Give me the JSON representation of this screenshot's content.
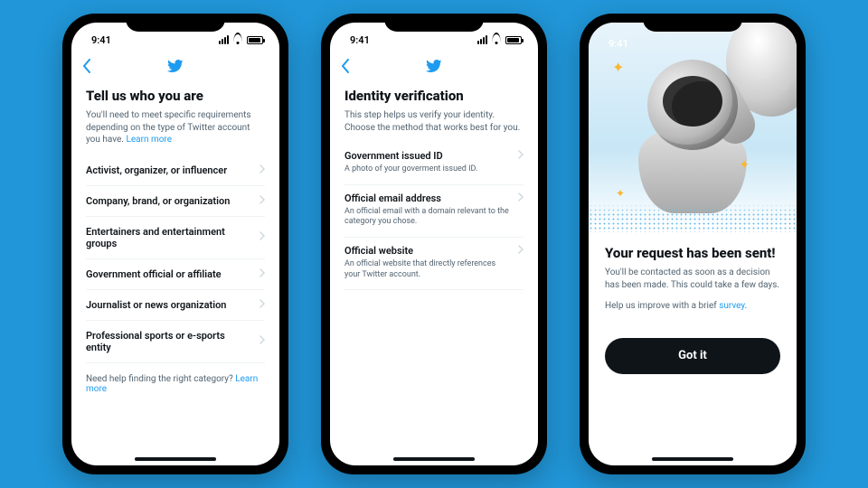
{
  "status": {
    "time": "9:41"
  },
  "brand": {
    "accent": "#1d9bf0"
  },
  "phone1": {
    "title": "Tell us who you are",
    "sub": "You'll need to meet specific requirements depending on the type of Twitter account you have.",
    "learn_more": "Learn more",
    "categories": [
      "Activist, organizer, or influencer",
      "Company, brand, or organization",
      "Entertainers and entertainment groups",
      "Government official or affiliate",
      "Journalist or news organization",
      "Professional sports or e-sports entity"
    ],
    "helper_prefix": "Need help finding the right category? ",
    "helper_link": "Learn more"
  },
  "phone2": {
    "title": "Identity verification",
    "sub": "This step helps us verify your identity. Choose the method that works best for you.",
    "options": [
      {
        "label": "Government issued ID",
        "desc": "A photo of your goverment issued ID."
      },
      {
        "label": "Official email address",
        "desc": "An official email with a domain relevant to the category you chose."
      },
      {
        "label": "Official website",
        "desc": "An official website that directly references your Twitter account."
      }
    ]
  },
  "phone3": {
    "title": "Your request has been sent!",
    "sub": "You'll be contacted as soon as a decision has been made. This could take a few days.",
    "survey_prefix": "Help us improve with a brief ",
    "survey_link": "survey",
    "survey_suffix": ".",
    "button": "Got it"
  }
}
